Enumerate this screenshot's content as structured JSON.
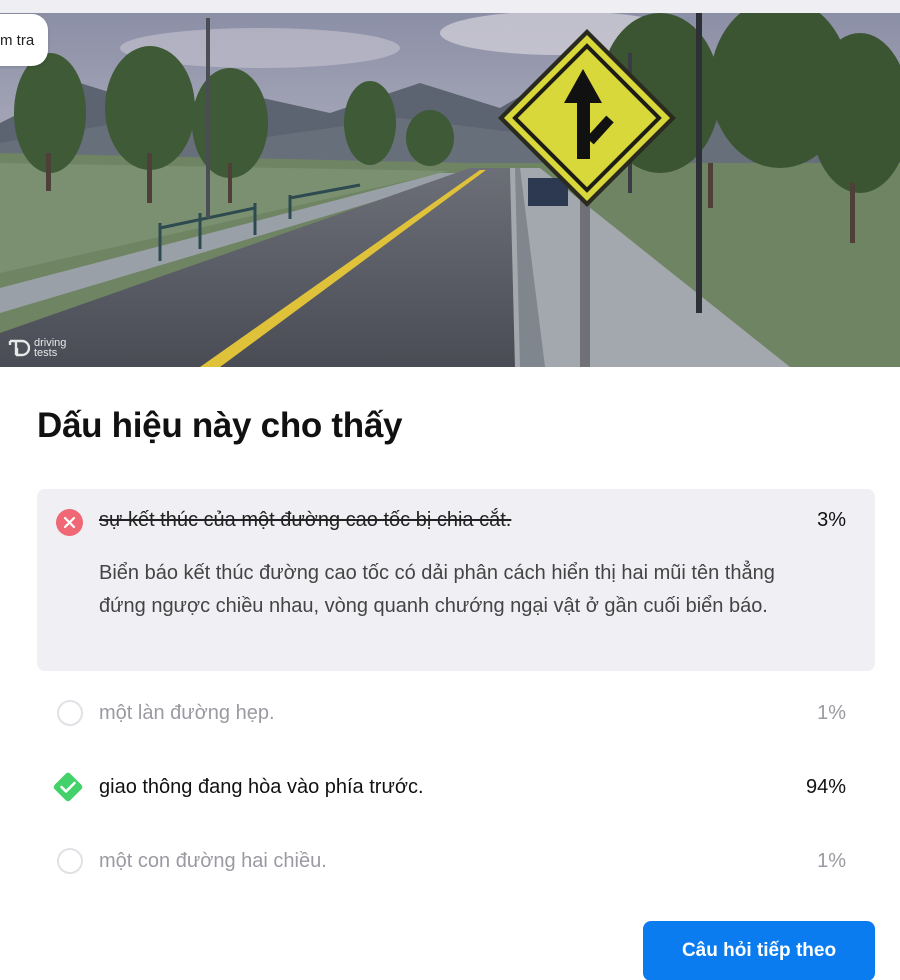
{
  "header": {
    "exam_label": "m tra"
  },
  "image": {
    "watermark_line1": "driving",
    "watermark_line2": "tests"
  },
  "question": {
    "title": "Dấu hiệu này cho thấy"
  },
  "options": [
    {
      "text": "sự kết thúc của một đường cao tốc bị chia cắt.",
      "percent": "3%",
      "state": "wrong",
      "explanation": "Biển báo kết thúc đường cao tốc có dải phân cách hiển thị hai mũi tên thẳng đứng ngược chiều nhau, vòng quanh chướng ngại vật ở gần cuối biển báo."
    },
    {
      "text": "một làn đường hẹp.",
      "percent": "1%",
      "state": "unselected"
    },
    {
      "text": "giao thông đang hòa vào phía trước.",
      "percent": "94%",
      "state": "correct"
    },
    {
      "text": "một con đường hai chiều.",
      "percent": "1%",
      "state": "unselected"
    }
  ],
  "actions": {
    "next_label": "Câu hỏi tiếp theo"
  },
  "colors": {
    "accent": "#0a7cf0",
    "wrong": "#f06775",
    "correct": "#43d26a",
    "sign_yellow": "#d8d83a"
  },
  "icons": [
    "close-icon",
    "empty-radio-icon",
    "check-icon",
    "merge-arrow-icon"
  ]
}
